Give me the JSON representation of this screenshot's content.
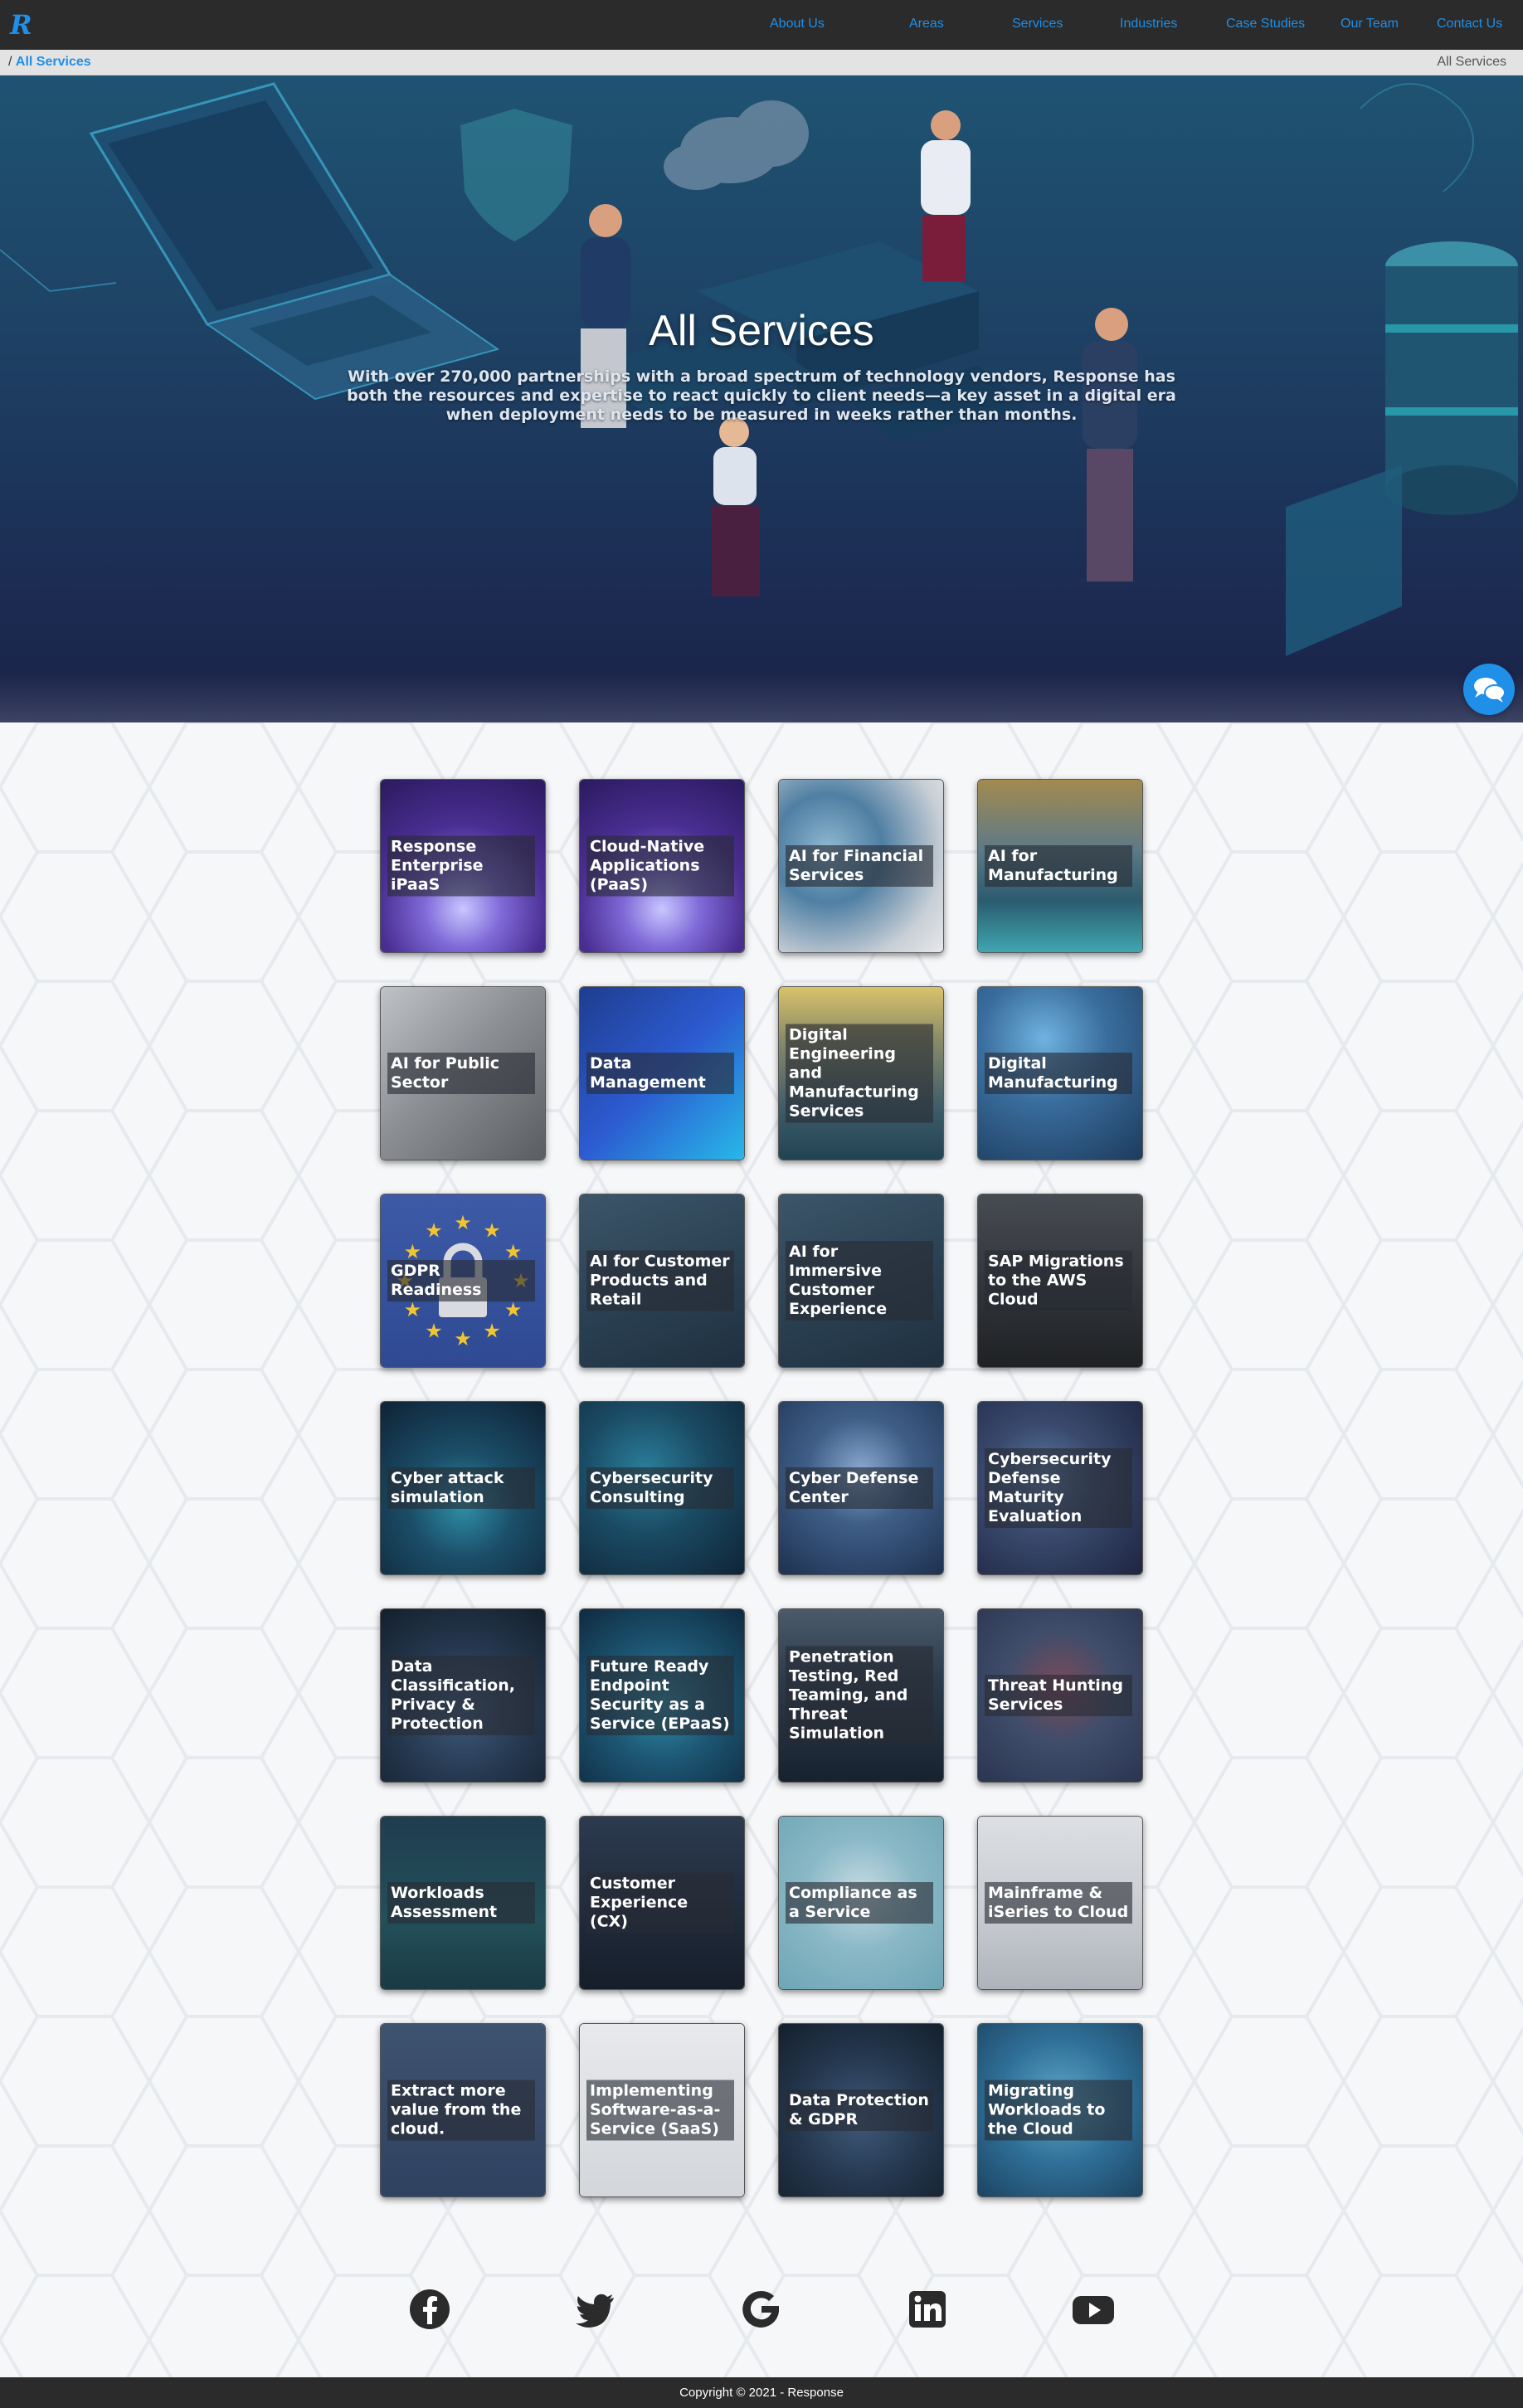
{
  "nav": {
    "logo": "R",
    "links": [
      "About Us",
      "Areas",
      "Services",
      "Industries",
      "Case Studies",
      "Our Team",
      "Contact Us"
    ]
  },
  "breadcrumb": {
    "separator": "/",
    "current": "All Services",
    "right": "All Services"
  },
  "hero": {
    "title": "All Services",
    "subtitle": "With over 270,000 partnerships with a broad spectrum of technology vendors, Response has both the resources and expertise to react quickly to client needs—a key asset in a digital era when deployment needs to be measured in weeks rather than months."
  },
  "services": [
    {
      "label": "Response Enterprise iPaaS",
      "theme": "purple-cloud"
    },
    {
      "label": "Cloud-Native Applications (PaaS)",
      "theme": "purple-cloud"
    },
    {
      "label": "AI for Financial Services",
      "theme": "ai-face"
    },
    {
      "label": "AI for Manufacturing",
      "theme": "robot-arms"
    },
    {
      "label": "AI for Public Sector",
      "theme": "grey-hands"
    },
    {
      "label": "Data Management",
      "theme": "blue-iso"
    },
    {
      "label": "Digital Engineering and Manufacturing Services",
      "theme": "engineer"
    },
    {
      "label": "Digital Manufacturing",
      "theme": "robot-blue"
    },
    {
      "label": "GDPR Readiness",
      "theme": "gdpr"
    },
    {
      "label": "AI for Customer Products and Retail",
      "theme": "dark-hand"
    },
    {
      "label": "AI for Immersive Customer Experience",
      "theme": "dark-hand"
    },
    {
      "label": "SAP Migrations to the AWS Cloud",
      "theme": "server"
    },
    {
      "label": "Cyber attack simulation",
      "theme": "cyber-red"
    },
    {
      "label": "Cybersecurity Consulting",
      "theme": "cyber-teal"
    },
    {
      "label": "Cyber Defense Center",
      "theme": "cyber-keyboard"
    },
    {
      "label": "Cybersecurity Defense Maturity Evaluation",
      "theme": "cyber-lens"
    },
    {
      "label": "Data Classification, Privacy & Protection",
      "theme": "data-dark"
    },
    {
      "label": "Future Ready Endpoint Security as a Service (EPaaS)",
      "theme": "endpoint"
    },
    {
      "label": "Penetration Testing, Red Teaming, and Threat Simulation",
      "theme": "pentest"
    },
    {
      "label": "Threat Hunting Services",
      "theme": "threat"
    },
    {
      "label": "Workloads Assessment",
      "theme": "workload"
    },
    {
      "label": "Customer Experience (CX)",
      "theme": "suit"
    },
    {
      "label": "Compliance as a Service",
      "theme": "compliance"
    },
    {
      "label": "Mainframe & iSeries to Cloud",
      "theme": "mainframe"
    },
    {
      "label": "Extract more value from the cloud.",
      "theme": "extract"
    },
    {
      "label": "Implementing Software-as-a-Service (SaaS)",
      "theme": "saas"
    },
    {
      "label": "Data Protection & GDPR",
      "theme": "data-protect"
    },
    {
      "label": "Migrating Workloads to the Cloud",
      "theme": "migrate"
    }
  ],
  "social": [
    "facebook",
    "twitter",
    "google",
    "linkedin",
    "youtube"
  ],
  "footer": {
    "copyright": "Copyright © 2021 - Response"
  },
  "colors": {
    "accent": "#1f8fe8",
    "nav_bg": "#2b2b2b"
  }
}
